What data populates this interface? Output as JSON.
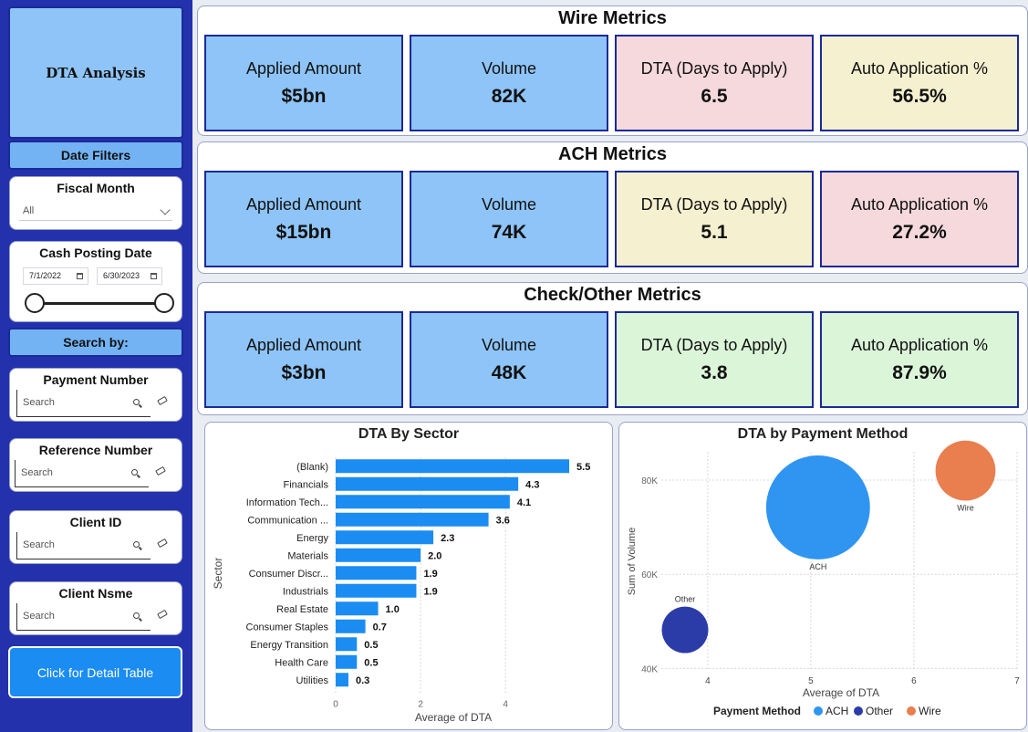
{
  "sidebar": {
    "title": "DTA Analysis",
    "date_filters_header": "Date Filters",
    "fiscal_month": {
      "label": "Fiscal Month",
      "value": "All"
    },
    "cash_posting_date": {
      "label": "Cash Posting Date",
      "start": "7/1/2022",
      "end": "6/30/2023"
    },
    "search_header": "Search by:",
    "search_fields": [
      {
        "label": "Payment Number",
        "placeholder": "Search"
      },
      {
        "label": "Reference Number",
        "placeholder": "Search"
      },
      {
        "label": "Client ID",
        "placeholder": "Search"
      },
      {
        "label": "Client Nsme",
        "placeholder": "Search"
      }
    ],
    "detail_button": "Click for Detail Table"
  },
  "metrics": [
    {
      "title": "Wire Metrics",
      "tiles": [
        {
          "label": "Applied Amount",
          "value": "$5bn",
          "color": "#8ec4f7"
        },
        {
          "label": "Volume",
          "value": "82K",
          "color": "#8ec4f7"
        },
        {
          "label": "DTA (Days to Apply)",
          "value": "6.5",
          "color": "#f5d9dd"
        },
        {
          "label": "Auto Application %",
          "value": "56.5%",
          "color": "#f5f0cf"
        }
      ]
    },
    {
      "title": "ACH Metrics",
      "tiles": [
        {
          "label": "Applied Amount",
          "value": "$15bn",
          "color": "#8ec4f7"
        },
        {
          "label": "Volume",
          "value": "74K",
          "color": "#8ec4f7"
        },
        {
          "label": "DTA (Days to Apply)",
          "value": "5.1",
          "color": "#f5f0cf"
        },
        {
          "label": "Auto Application %",
          "value": "27.2%",
          "color": "#f5d9dd"
        }
      ]
    },
    {
      "title": "Check/Other Metrics",
      "tiles": [
        {
          "label": "Applied Amount",
          "value": "$3bn",
          "color": "#8ec4f7"
        },
        {
          "label": "Volume",
          "value": "48K",
          "color": "#8ec4f7"
        },
        {
          "label": "DTA (Days to Apply)",
          "value": "3.8",
          "color": "#dbf5d9"
        },
        {
          "label": "Auto Application %",
          "value": "87.9%",
          "color": "#dbf5d9"
        }
      ]
    }
  ],
  "chart_data": [
    {
      "type": "bar",
      "orientation": "horizontal",
      "title": "DTA By Sector",
      "xlabel": "Average of DTA",
      "ylabel": "Sector",
      "categories": [
        "(Blank)",
        "Financials",
        "Information Tech...",
        "Communication ...",
        "Energy",
        "Materials",
        "Consumer Discr...",
        "Industrials",
        "Real Estate",
        "Consumer Staples",
        "Energy Transition",
        "Health Care",
        "Utilities"
      ],
      "values": [
        5.5,
        4.3,
        4.1,
        3.6,
        2.3,
        2.0,
        1.9,
        1.9,
        1.0,
        0.7,
        0.5,
        0.5,
        0.3
      ],
      "value_labels": [
        "5.5",
        "4.3",
        "4.1",
        "3.6",
        "2.3",
        "2.0",
        "1.9",
        "1.9",
        "1.0",
        "0.7",
        "0.5",
        "0.5",
        "0.3"
      ],
      "xlim": [
        0,
        5.8
      ],
      "xticks": [
        0,
        2,
        4
      ],
      "bar_color": "#1a8cf2",
      "grid": true
    },
    {
      "type": "scatter",
      "title": "DTA by Payment Method",
      "xlabel": "Average of DTA",
      "ylabel": "Sum of Volume",
      "xlim": [
        3.55,
        7.0
      ],
      "ylim": [
        39.5,
        86
      ],
      "xticks": [
        4,
        5,
        6,
        7
      ],
      "yticks": [
        40,
        60,
        80
      ],
      "ytick_labels": [
        "40K",
        "60K",
        "80K"
      ],
      "legend_title": "Payment Method",
      "legend_position": "bottom",
      "points": [
        {
          "name": "ACH",
          "x": 5.07,
          "y": 74.2,
          "size": 15,
          "color": "#2f95f0"
        },
        {
          "name": "Other",
          "x": 3.78,
          "y": 48.2,
          "size": 3,
          "color": "#2b3ba8"
        },
        {
          "name": "Wire",
          "x": 6.5,
          "y": 82.0,
          "size": 5,
          "color": "#e97e4e"
        }
      ],
      "grid": true
    }
  ]
}
